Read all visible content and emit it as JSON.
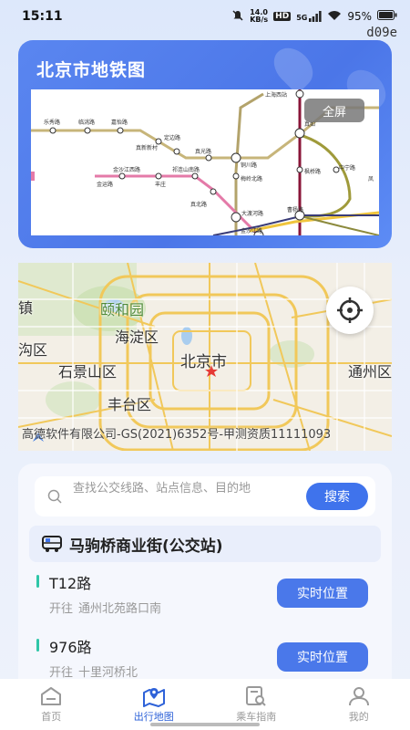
{
  "status": {
    "time": "15:11",
    "net_speed": "14.0\nKB/s",
    "net_speed_top": "14.0",
    "net_speed_bottom": "KB/s",
    "hd": "HD",
    "signal": "5G",
    "battery": "95%",
    "device_code": "d09e"
  },
  "metro": {
    "title": "北京市地铁图",
    "fullscreen_label": "全屏",
    "stations": [
      "上海西站",
      "乐秀路",
      "临洮路",
      "嘉怡路",
      "定边路",
      "真新新村",
      "真光路",
      "金沙江西路",
      "祁连山南路",
      "丰庄",
      "金运路",
      "铜川路",
      "梅岭北路",
      "真北路",
      "大渡河路",
      "曹杨路",
      "枫桥路",
      "中宁路",
      "真如",
      "凤"
    ]
  },
  "city_map": {
    "labels": [
      "颐和园",
      "海淀区",
      "北京市",
      "石景山区",
      "丰台区",
      "通州区",
      "沟区",
      "镇"
    ],
    "copyright": "高德软件有限公司-GS(2021)6352号-甲测资质11111093"
  },
  "panel": {
    "search_placeholder": "查找公交线路、站点信息、目的地",
    "search_button": "搜索",
    "station_name": "马驹桥商业街(公交站)",
    "routes": [
      {
        "name": "T12路",
        "dir_prefix": "开往",
        "dir": "通州北苑路口南",
        "button": "实时位置"
      },
      {
        "name": "976路",
        "dir_prefix": "开往",
        "dir": "十里河桥北",
        "button": "实时位置"
      }
    ]
  },
  "tabs": [
    {
      "label": "首页",
      "active": false
    },
    {
      "label": "出行地图",
      "active": true
    },
    {
      "label": "乘车指南",
      "active": false
    },
    {
      "label": "我的",
      "active": false
    }
  ],
  "colors": {
    "accent": "#3f73ec",
    "route_bar": "#2fc6a8",
    "active_tab": "#2e62d8"
  }
}
